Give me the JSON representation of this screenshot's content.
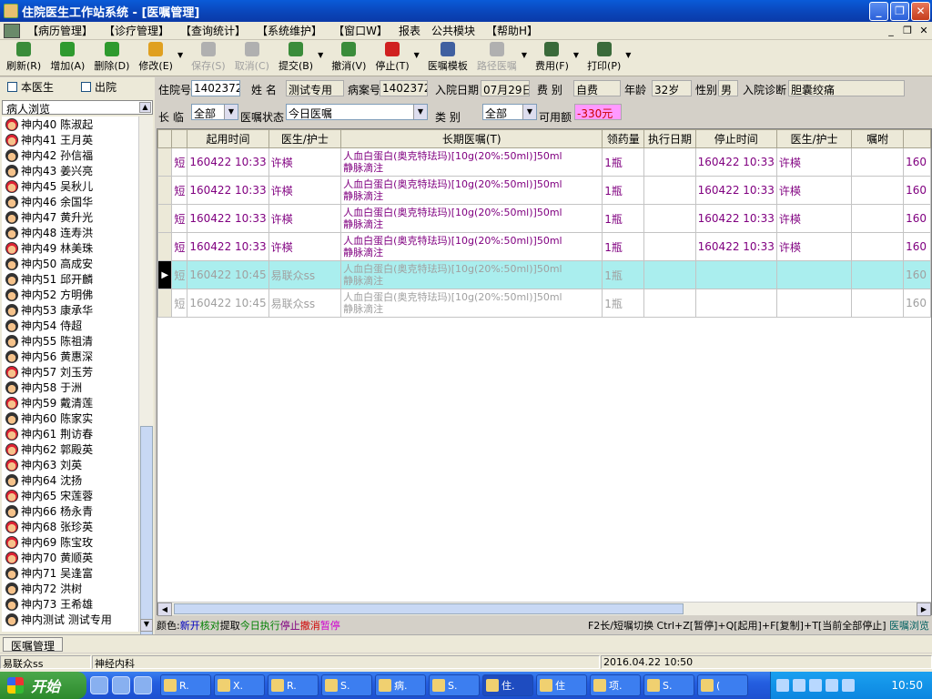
{
  "window": {
    "title": "住院医生工作站系统 - [医嘱管理]"
  },
  "menu": [
    "【病历管理】",
    "【诊疗管理】",
    "【查询统计】",
    "【系统维护】",
    "【窗口W】",
    "报表",
    "公共模块",
    "【帮助H】"
  ],
  "toolbar": [
    {
      "label": "刷新(R)",
      "icon": "refresh-icon",
      "color": "#3a8c3a",
      "enabled": true
    },
    {
      "label": "增加(A)",
      "icon": "add-icon",
      "color": "#2e9a2e",
      "enabled": true
    },
    {
      "label": "删除(D)",
      "icon": "delete-icon",
      "color": "#2e9a2e",
      "enabled": true
    },
    {
      "label": "修改(E)",
      "icon": "edit-icon",
      "color": "#e0a020",
      "enabled": true
    },
    {
      "label": "保存(S)",
      "icon": "save-icon",
      "color": "#b0b0b0",
      "enabled": false
    },
    {
      "label": "取消(C)",
      "icon": "cancel-icon",
      "color": "#b0b0b0",
      "enabled": false
    },
    {
      "label": "提交(B)",
      "icon": "submit-icon",
      "color": "#3a8c3a",
      "enabled": true
    },
    {
      "label": "撤消(V)",
      "icon": "undo-icon",
      "color": "#3a8c3a",
      "enabled": true
    },
    {
      "label": "停止(T)",
      "icon": "stop-icon",
      "color": "#d02020",
      "enabled": true
    },
    {
      "label": "医嘱模板",
      "icon": "template-icon",
      "color": "#4060a0",
      "enabled": true
    },
    {
      "label": "路径医嘱",
      "icon": "pathway-icon",
      "color": "#b0b0b0",
      "enabled": false
    },
    {
      "label": "费用(F)",
      "icon": "fee-icon",
      "color": "#3a6a3a",
      "enabled": true
    },
    {
      "label": "打印(P)",
      "icon": "print-icon",
      "color": "#3a6a3a",
      "enabled": true
    }
  ],
  "left": {
    "cb_own": "本医生",
    "cb_discharged": "出院",
    "browse_header": "病人浏览",
    "patients": [
      {
        "name": "神内40 陈淑起",
        "g": "f"
      },
      {
        "name": "神内41 王月英",
        "g": "f"
      },
      {
        "name": "神内42 孙信福",
        "g": "m"
      },
      {
        "name": "神内43 姜兴亮",
        "g": "m"
      },
      {
        "name": "神内45 吴秋儿",
        "g": "f"
      },
      {
        "name": "神内46 余国华",
        "g": "m"
      },
      {
        "name": "神内47 黄升光",
        "g": "m"
      },
      {
        "name": "神内48 连寿洪",
        "g": "m"
      },
      {
        "name": "神内49 林美珠",
        "g": "f"
      },
      {
        "name": "神内50 高成安",
        "g": "m"
      },
      {
        "name": "神内51 邱开麟",
        "g": "m"
      },
      {
        "name": "神内52 方明佛",
        "g": "m"
      },
      {
        "name": "神内53 康承华",
        "g": "m"
      },
      {
        "name": "神内54 侍超",
        "g": "m"
      },
      {
        "name": "神内55 陈祖清",
        "g": "m"
      },
      {
        "name": "神内56 黄惠深",
        "g": "m"
      },
      {
        "name": "神内57 刘玉芳",
        "g": "f"
      },
      {
        "name": "神内58 于洲",
        "g": "m"
      },
      {
        "name": "神内59 戴清莲",
        "g": "f"
      },
      {
        "name": "神内60 陈家实",
        "g": "m"
      },
      {
        "name": "神内61 荆访春",
        "g": "f"
      },
      {
        "name": "神内62 郭殿英",
        "g": "f"
      },
      {
        "name": "神内63 刘英",
        "g": "f"
      },
      {
        "name": "神内64 沈扬",
        "g": "m"
      },
      {
        "name": "神内65 宋莲蓉",
        "g": "f"
      },
      {
        "name": "神内66 杨永青",
        "g": "m"
      },
      {
        "name": "神内68 张珍英",
        "g": "f"
      },
      {
        "name": "神内69 陈宝玫",
        "g": "f"
      },
      {
        "name": "神内70 黄顺英",
        "g": "f"
      },
      {
        "name": "神内71 吴逢富",
        "g": "m"
      },
      {
        "name": "神内72 洪树",
        "g": "m"
      },
      {
        "name": "神内73 王希雄",
        "g": "m"
      },
      {
        "name": "神内测试 测试专用",
        "g": "m"
      }
    ]
  },
  "info": {
    "inpatient_no_label": "住院号",
    "inpatient_no": "1402372",
    "name_label": "姓  名",
    "name": "测试专用",
    "record_no_label": "病案号",
    "record_no": "1402372",
    "admit_date_label": "入院日期",
    "admit_date": "07月29日",
    "fee_type_label": "费  别",
    "fee_type": "自费",
    "age_label": "年龄",
    "age": "32岁",
    "sex_label": "性别",
    "sex": "男",
    "diagnosis_label": "入院诊断",
    "diagnosis": "胆囊绞痛",
    "longtemp_label": "长  临",
    "longtemp": "全部",
    "order_status_label": "医嘱状态",
    "order_status": "今日医嘱",
    "class_label": "类      别",
    "class_value": "全部",
    "balance_label": "可用额",
    "balance": "-330元"
  },
  "grid": {
    "headers": [
      "起用时间",
      "医生/护士",
      "长期医嘱(T)",
      "领药量",
      "执行日期",
      "停止时间",
      "医生/护士",
      "嘱咐",
      ""
    ],
    "rows": [
      {
        "type": "短",
        "start": "160422 10:33",
        "doctor": "许楧",
        "order1": "人血白蛋白(奥克特珐玛)[10g(20%:50ml)]50ml",
        "order2": "静脉滴注",
        "qty": "1瓶",
        "exec": "",
        "stop": "160422 10:33",
        "stop_doctor": "许楧",
        "note": "",
        "extra": "160",
        "style": "purple"
      },
      {
        "type": "短",
        "start": "160422 10:33",
        "doctor": "许楧",
        "order1": "人血白蛋白(奥克特珐玛)[10g(20%:50ml)]50ml",
        "order2": "静脉滴注",
        "qty": "1瓶",
        "exec": "",
        "stop": "160422 10:33",
        "stop_doctor": "许楧",
        "note": "",
        "extra": "160",
        "style": "purple"
      },
      {
        "type": "短",
        "start": "160422 10:33",
        "doctor": "许楧",
        "order1": "人血白蛋白(奥克特珐玛)[10g(20%:50ml)]50ml",
        "order2": "静脉滴注",
        "qty": "1瓶",
        "exec": "",
        "stop": "160422 10:33",
        "stop_doctor": "许楧",
        "note": "",
        "extra": "160",
        "style": "purple"
      },
      {
        "type": "短",
        "start": "160422 10:33",
        "doctor": "许楧",
        "order1": "人血白蛋白(奥克特珐玛)[10g(20%:50ml)]50ml",
        "order2": "静脉滴注",
        "qty": "1瓶",
        "exec": "",
        "stop": "160422 10:33",
        "stop_doctor": "许楧",
        "note": "",
        "extra": "160",
        "style": "purple"
      },
      {
        "type": "短",
        "start": "160422 10:45",
        "doctor": "易联众ss",
        "order1": "人血白蛋白(奥克特珐玛)[10g(20%:50ml)]50ml",
        "order2": "静脉滴注",
        "qty": "1瓶",
        "exec": "",
        "stop": "",
        "stop_doctor": "",
        "note": "",
        "extra": "160",
        "style": "gray sel"
      },
      {
        "type": "短",
        "start": "160422 10:45",
        "doctor": "易联众ss",
        "order1": "人血白蛋白(奥克特珐玛)[10g(20%:50ml)]50ml",
        "order2": "静脉滴注",
        "qty": "1瓶",
        "exec": "",
        "stop": "",
        "stop_doctor": "",
        "note": "",
        "extra": "160",
        "style": "gray"
      }
    ]
  },
  "legend": {
    "prefix": "颜色:",
    "items": [
      {
        "text": "新开",
        "color": "#0000c0"
      },
      {
        "text": "核对",
        "color": "#008000"
      },
      {
        "text": "提取",
        "color": "#000000"
      },
      {
        "text": "今日执行",
        "color": "#008000"
      },
      {
        "text": "停止",
        "color": "#800080"
      },
      {
        "text": "撤消",
        "color": "#d00000"
      },
      {
        "text": "暂停",
        "color": "#d000d0"
      }
    ],
    "hint": "F2长/短嘱切换 Ctrl+Z[暂停]+Q[起用]+F[复制]+T[当前全部停止]",
    "hint_link": "医嘱浏览",
    "hint_link_color": "#006060"
  },
  "tabs": {
    "active": "医嘱管理"
  },
  "status": {
    "user": "易联众ss",
    "dept": "神经内科",
    "datetime": "2016.04.22 10:50"
  },
  "taskbar": {
    "start": "开始",
    "tasks": [
      "R.",
      "X.",
      "R.",
      "S.",
      "病.",
      "S.",
      "住.",
      "住",
      "项.",
      "S.",
      "("
    ],
    "active_index": 6,
    "clock": "10:50"
  },
  "colors": {
    "title_bar": "#0a44b8",
    "selected_row": "#aaeeee",
    "balance_bg": "#ff99ff",
    "balance_fg": "#cc0000"
  }
}
